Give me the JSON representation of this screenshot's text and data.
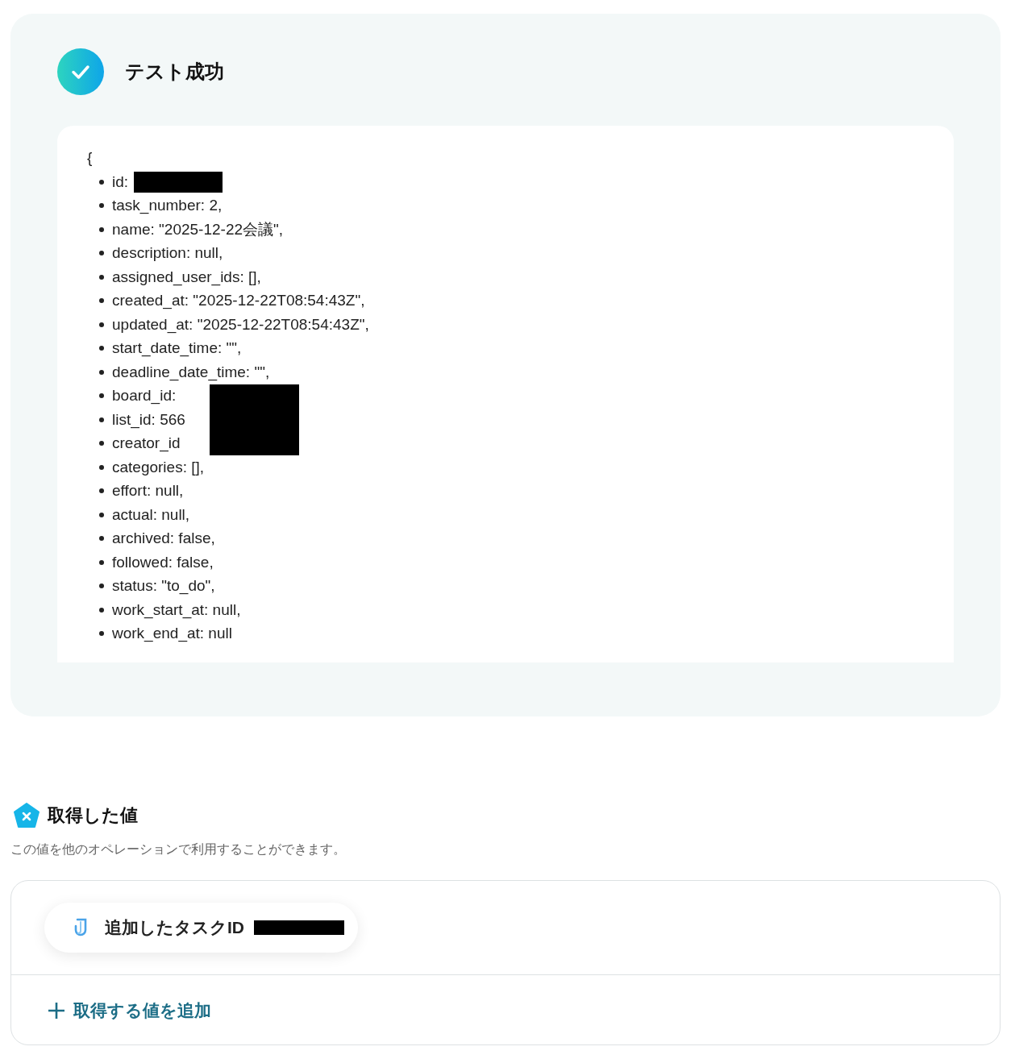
{
  "result": {
    "title": "テスト成功",
    "open_brace": "{",
    "fields": [
      {
        "text": "id:",
        "redacted": true
      },
      {
        "text": "task_number: 2,",
        "redacted": false
      },
      {
        "text": "name: \"2025-12-22会議\",",
        "redacted": false
      },
      {
        "text": "description: null,",
        "redacted": false
      },
      {
        "text": "assigned_user_ids: [],",
        "redacted": false
      },
      {
        "text": "created_at: \"2025-12-22T08:54:43Z\",",
        "redacted": false
      },
      {
        "text": "updated_at: \"2025-12-22T08:54:43Z\",",
        "redacted": false
      },
      {
        "text": "start_date_time: \"\",",
        "redacted": false
      },
      {
        "text": "deadline_date_time: \"\",",
        "redacted": false
      },
      {
        "text": "board_id:",
        "redacted": true
      },
      {
        "text": "list_id: 566",
        "redacted": true
      },
      {
        "text": "creator_id",
        "redacted": true
      },
      {
        "text": "categories: [],",
        "redacted": false
      },
      {
        "text": "effort: null,",
        "redacted": false
      },
      {
        "text": "actual: null,",
        "redacted": false
      },
      {
        "text": "archived: false,",
        "redacted": false
      },
      {
        "text": "followed: false,",
        "redacted": false
      },
      {
        "text": "status: \"to_do\",",
        "redacted": false
      },
      {
        "text": "work_start_at: null,",
        "redacted": false
      },
      {
        "text": "work_end_at: null",
        "redacted": false
      }
    ]
  },
  "values": {
    "title": "取得した値",
    "description": "この値を他のオペレーションで利用することができます。",
    "items": [
      {
        "label": "追加したタスクID",
        "redacted": true
      }
    ],
    "add_button": "取得する値を追加"
  }
}
